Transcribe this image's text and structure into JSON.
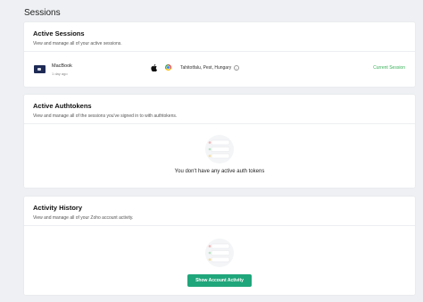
{
  "page": {
    "title": "Sessions"
  },
  "active_sessions": {
    "title": "Active Sessions",
    "description": "View and manage all of your active sessions.",
    "sessions": [
      {
        "device": "MacBook",
        "time": "1 day ago",
        "os_icon": "apple-icon",
        "browser_icon": "chrome-icon",
        "location": "Tahitotfalu, Pest, Hungary",
        "status": "Current Session"
      }
    ]
  },
  "active_authtokens": {
    "title": "Active Authtokens",
    "description": "View and manage all of the sessions you've signed in to with authtokens.",
    "empty_message": "You don't have any active auth tokens"
  },
  "activity_history": {
    "title": "Activity History",
    "description": "View and manage all of your Zoho account activity.",
    "button_label": "Show Account Activity"
  },
  "colors": {
    "accent_green": "#1fa67a",
    "status_green": "#3bb35b",
    "background": "#eef0f3"
  }
}
